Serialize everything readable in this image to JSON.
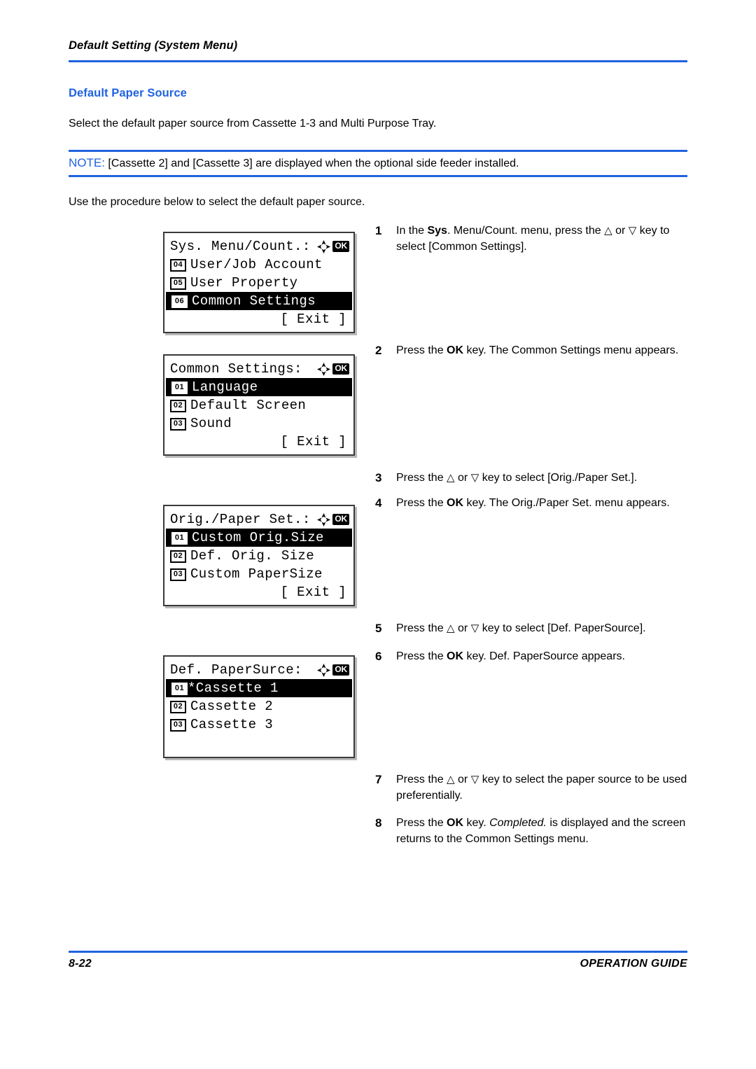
{
  "page": {
    "running_header": "Default Setting (System Menu)",
    "section_heading": "Default Paper Source",
    "intro_paragraph": "Select the default paper source from Cassette 1-3 and Multi Purpose Tray.",
    "note_label": "NOTE:",
    "note_text": "[Cassette 2] and [Cassette 3] are displayed when the optional side feeder installed.",
    "use_paragraph": "Use the procedure below to select the default paper source.",
    "accent_color": "#1f63e0"
  },
  "footer": {
    "page_number": "8-22",
    "guide_label": "OPERATION GUIDE"
  },
  "lcd_panels": [
    {
      "title": "Sys. Menu/Count.:",
      "keys": [
        "arrow-cluster-icon",
        "ok-key-icon"
      ],
      "rows": [
        {
          "index": "04",
          "label": "User/Job Account",
          "highlighted": false
        },
        {
          "index": "05",
          "label": "User Property",
          "highlighted": false
        },
        {
          "index": "06",
          "label": "Common Settings",
          "highlighted": true
        }
      ],
      "softkey": "[  Exit  ]"
    },
    {
      "title": "Common Settings:",
      "keys": [
        "arrow-cluster-icon",
        "ok-key-icon"
      ],
      "rows": [
        {
          "index": "01",
          "label": "Language",
          "highlighted": true
        },
        {
          "index": "02",
          "label": "Default Screen",
          "highlighted": false
        },
        {
          "index": "03",
          "label": "Sound",
          "highlighted": false
        }
      ],
      "softkey": "[  Exit  ]"
    },
    {
      "title": "Orig./Paper Set.:",
      "keys": [
        "arrow-cluster-icon",
        "ok-key-icon"
      ],
      "rows": [
        {
          "index": "01",
          "label": "Custom Orig.Size",
          "highlighted": true
        },
        {
          "index": "02",
          "label": "Def. Orig. Size",
          "highlighted": false
        },
        {
          "index": "03",
          "label": "Custom PaperSize",
          "highlighted": false
        }
      ],
      "softkey": "[  Exit  ]"
    },
    {
      "title": "Def. PaperSurce:",
      "keys": [
        "arrow-cluster-icon",
        "ok-key-icon"
      ],
      "rows": [
        {
          "index": "01",
          "label": "*Cassette 1",
          "highlighted": true
        },
        {
          "index": "02",
          "label": "Cassette 2",
          "highlighted": false
        },
        {
          "index": "03",
          "label": "Cassette 3",
          "highlighted": false
        }
      ],
      "softkey": ""
    }
  ],
  "steps": [
    {
      "num": "1",
      "text": "In the Sys. Menu/Count. menu, press the △ or ▽ key to select [Common Settings]."
    },
    {
      "num": "2",
      "text": "Press the OK key. The Common Settings menu appears."
    },
    {
      "num": "3",
      "text": "Press the △ or ▽ key to select [Orig./Paper Set.]."
    },
    {
      "num": "4",
      "text": "Press the OK key. The Orig./Paper Set. menu appears."
    },
    {
      "num": "5",
      "text": "Press the △ or ▽ key to select [Def. PaperSource]."
    },
    {
      "num": "6",
      "text": "Press the OK key. Def. PaperSource appears."
    },
    {
      "num": "7",
      "text": "Press the △ or ▽ key to select the paper source to be used preferentially."
    },
    {
      "num": "8",
      "text": "Press the OK key. Completed. is displayed and the screen returns to the Common Settings menu."
    }
  ]
}
